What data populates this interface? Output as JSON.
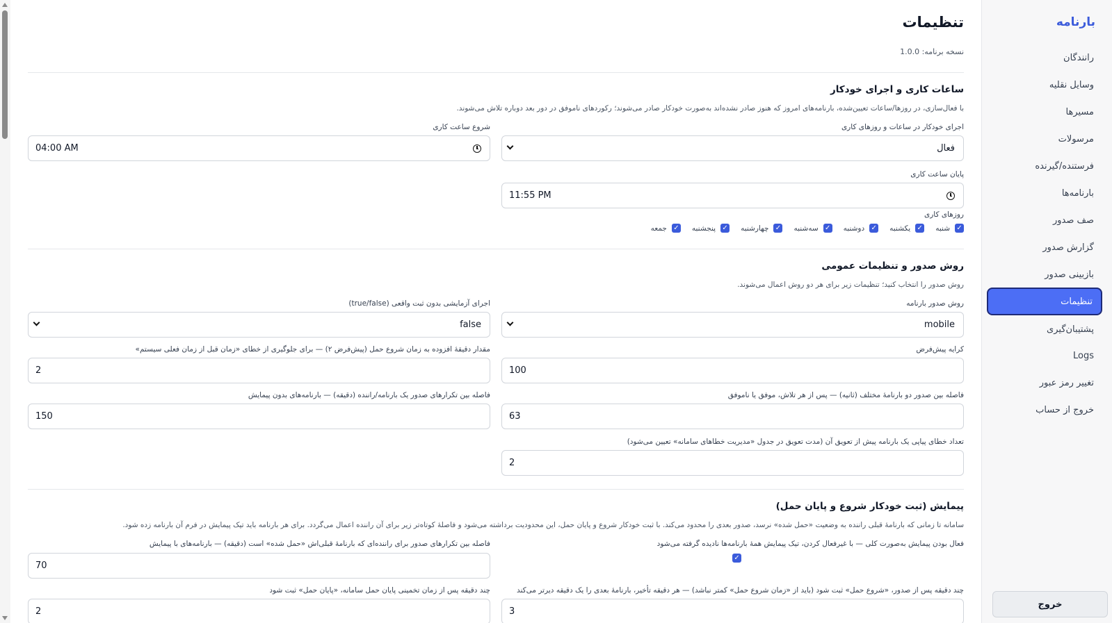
{
  "sidebar": {
    "brand": "بارنامه",
    "items": [
      {
        "label": "رانندگان"
      },
      {
        "label": "وسایل نقلیه"
      },
      {
        "label": "مسیرها"
      },
      {
        "label": "مرسولات"
      },
      {
        "label": "فرستنده/گیرنده"
      },
      {
        "label": "بارنامه‌ها"
      },
      {
        "label": "صف صدور"
      },
      {
        "label": "گزارش صدور"
      },
      {
        "label": "بازبینی صدور"
      },
      {
        "label": "تنظیمات",
        "active": true
      },
      {
        "label": "پشتیبان‌گیری"
      },
      {
        "label": "Logs"
      },
      {
        "label": "تغییر رمز عبور"
      },
      {
        "label": "خروج از حساب"
      }
    ],
    "logout_button": "خروج"
  },
  "page": {
    "title": "تنظیمات",
    "version": "نسخه برنامه: 1.0.0"
  },
  "section_hours": {
    "title": "ساعات کاری و اجرای خودکار",
    "description": "با فعال‌سازی، در روزها/ساعات تعیین‌شده، بارنامه‌های امروز که هنوز صادر نشده‌اند به‌صورت خودکار صادر می‌شوند؛ رکوردهای ناموفق در دور بعد دوباره تلاش می‌شوند.",
    "auto_run_label": "اجرای خودکار در ساعات و روزهای کاری",
    "auto_run_value": "فعال",
    "start_label": "شروع ساعت کاری",
    "start_value": "04:00 AM",
    "end_label": "پایان ساعت کاری",
    "end_value": "11:55 PM",
    "days_label": "روزهای کاری",
    "days": [
      {
        "label": "شنبه",
        "checked": true
      },
      {
        "label": "یکشنبه",
        "checked": true
      },
      {
        "label": "دوشنبه",
        "checked": true
      },
      {
        "label": "سه‌شنبه",
        "checked": true
      },
      {
        "label": "چهارشنبه",
        "checked": true
      },
      {
        "label": "پنجشنبه",
        "checked": true
      },
      {
        "label": "جمعه",
        "checked": true
      }
    ]
  },
  "section_issue": {
    "title": "روش صدور و تنظیمات عمومی",
    "description": "روش صدور را انتخاب کنید؛ تنظیمات زیر برای هر دو روش اعمال می‌شوند.",
    "method_label": "روش صدور بارنامه",
    "method_value": "mobile",
    "dryrun_label": "اجرای آزمایشی بدون ثبت واقعی (true/false)",
    "dryrun_value": "false",
    "fare_label": "کرایه پیش‌فرض",
    "fare_value": "100",
    "minutes_label": "مقدار دقیقهٔ افزوده به زمان شروع حمل (پیش‌فرض ۲) — برای جلوگیری از خطای «زمان قبل از زمان فعلی سیستم»",
    "minutes_value": "2",
    "gap_label": "فاصله بین صدور دو بارنامهٔ مختلف (ثانیه) — پس از هر تلاش، موفق یا ناموفق",
    "gap_value": "63",
    "repeat_label": "فاصله بین تکرارهای صدور یک بارنامه/راننده (دقیقه) — بارنامه‌های بدون پیمایش",
    "repeat_value": "150",
    "errors_label": "تعداد خطای پیاپی یک بارنامه پیش از تعویق آن (مدت تعویق در جدول «مدیریت خطاهای سامانه» تعیین می‌شود)",
    "errors_value": "2"
  },
  "section_trip": {
    "title": "پیمایش (ثبت خودکار شروع و پایان حمل)",
    "description": "سامانه تا زمانی که بارنامهٔ قبلی راننده به وضعیت «حمل شده» نرسد، صدور بعدی را محدود می‌کند. با ثبت خودکار شروع و پایان حمل، این محدودیت برداشته می‌شود و فاصلهٔ کوتاه‌تر زیر برای آن راننده اعمال می‌گردد. برای هر بارنامه باید تیک پیمایش در فرم آن بارنامه زده شود.",
    "enabled_label": "فعال بودن پیمایش به‌صورت کلی — با غیرفعال کردن، تیک پیمایش همهٔ بارنامه‌ها نادیده گرفته می‌شود",
    "enabled_checked": true,
    "gap_label": "فاصله بین تکرارهای صدور برای راننده‌ای که بارنامهٔ قبلی‌اش «حمل شده» است (دقیقه) — بارنامه‌های با پیمایش",
    "gap_value": "70",
    "start_label": "چند دقیقه پس از صدور، «شروع حمل» ثبت شود (باید از «زمان شروع حمل» کمتر نباشد) — هر دقیقه تأخیر، بارنامهٔ بعدی را یک دقیقه دیرتر می‌کند",
    "start_value": "3",
    "end_label": "چند دقیقه پس از زمان تخمینی پایان حمل سامانه، «پایان حمل» ثبت شود",
    "end_value": "2"
  }
}
